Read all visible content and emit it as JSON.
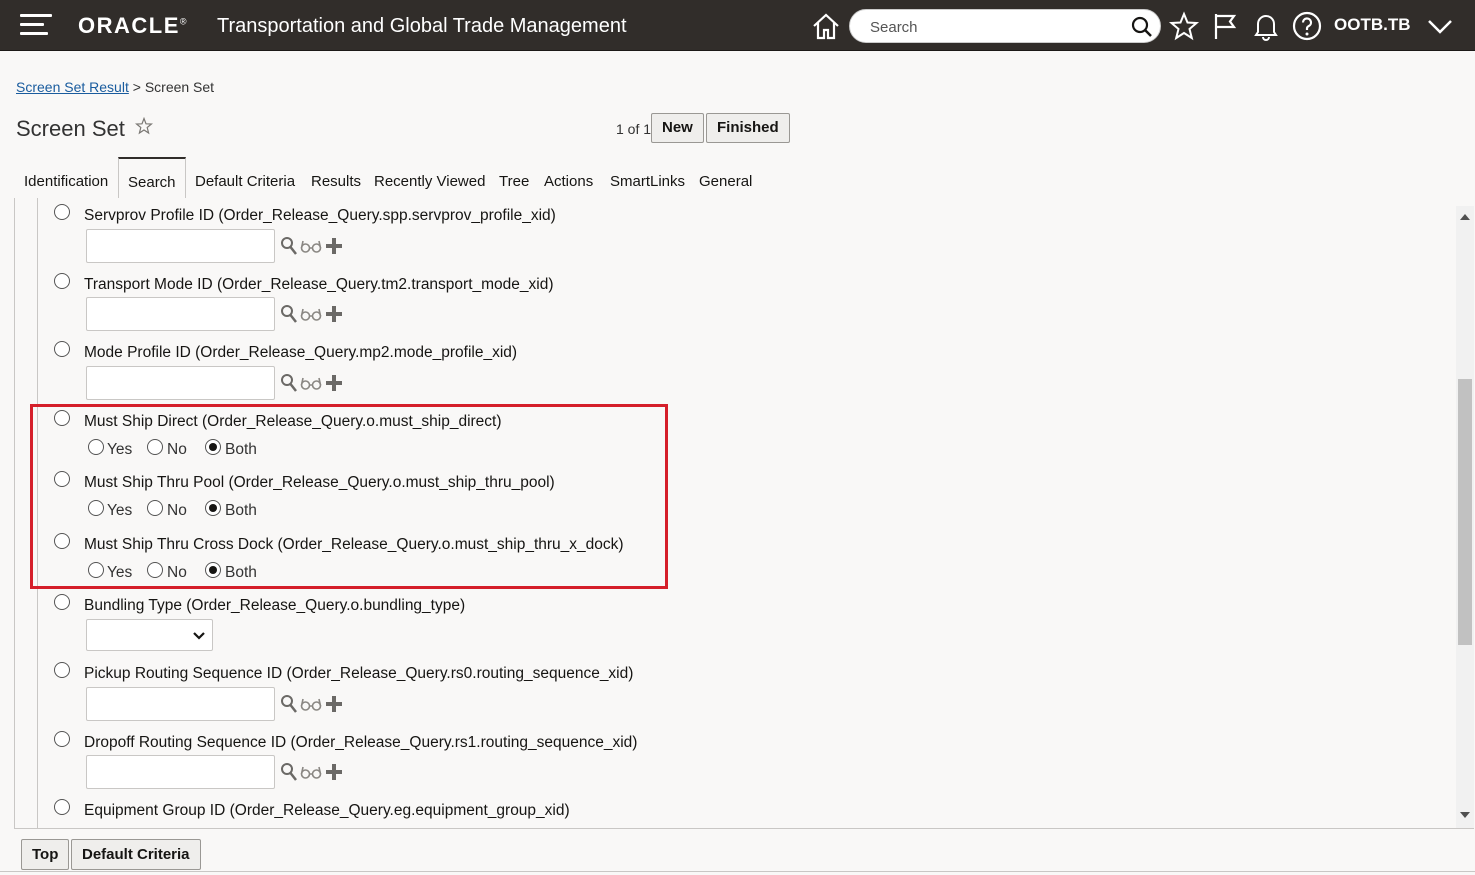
{
  "header": {
    "brand": "ORACLE",
    "product": "Transportation and Global Trade Management",
    "search_placeholder": "Search",
    "user": "OOTB.TB"
  },
  "breadcrumb": {
    "link": "Screen Set Result",
    "separator": ">",
    "current": "Screen Set"
  },
  "page": {
    "title": "Screen Set",
    "pager": "1 of 1",
    "new_label": "New",
    "finished_label": "Finished"
  },
  "tabs": [
    "Identification",
    "Search",
    "Default Criteria",
    "Results",
    "Recently Viewed",
    "Tree",
    "Actions",
    "SmartLinks",
    "General"
  ],
  "active_tab": "Search",
  "fields": [
    {
      "label": "Servprov Profile ID (Order_Release_Query.spp.servprov_profile_xid)",
      "type": "text"
    },
    {
      "label": "Transport Mode ID (Order_Release_Query.tm2.transport_mode_xid)",
      "type": "text"
    },
    {
      "label": "Mode Profile ID (Order_Release_Query.mp2.mode_profile_xid)",
      "type": "text"
    },
    {
      "label": "Must Ship Direct (Order_Release_Query.o.must_ship_direct)",
      "type": "yesnoboth",
      "value": "Both"
    },
    {
      "label": "Must Ship Thru Pool (Order_Release_Query.o.must_ship_thru_pool)",
      "type": "yesnoboth",
      "value": "Both"
    },
    {
      "label": "Must Ship Thru Cross Dock (Order_Release_Query.o.must_ship_thru_x_dock)",
      "type": "yesnoboth",
      "value": "Both"
    },
    {
      "label": "Bundling Type (Order_Release_Query.o.bundling_type)",
      "type": "select"
    },
    {
      "label": "Pickup Routing Sequence ID (Order_Release_Query.rs0.routing_sequence_xid)",
      "type": "text"
    },
    {
      "label": "Dropoff Routing Sequence ID (Order_Release_Query.rs1.routing_sequence_xid)",
      "type": "text"
    },
    {
      "label": "Equipment Group ID (Order_Release_Query.eg.equipment_group_xid)",
      "type": "text"
    }
  ],
  "options": {
    "yes": "Yes",
    "no": "No",
    "both": "Both"
  },
  "footer": {
    "top_label": "Top",
    "default_criteria_label": "Default Criteria"
  },
  "colors": {
    "header_bg": "#312d2a",
    "highlight": "#d51f2a",
    "link": "#1a5c9e"
  }
}
